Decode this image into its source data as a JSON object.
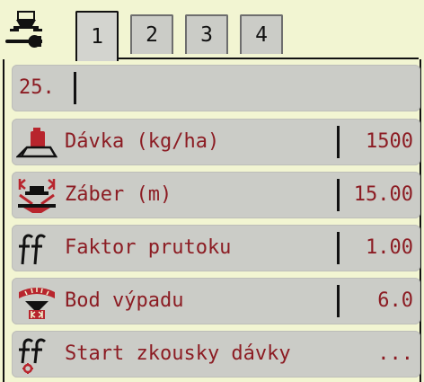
{
  "tabs": [
    {
      "label": "1",
      "active": true
    },
    {
      "label": "2",
      "active": false
    },
    {
      "label": "3",
      "active": false
    },
    {
      "label": "4",
      "active": false
    }
  ],
  "input_row": {
    "value": "25."
  },
  "rows": [
    {
      "label": "Dávka (kg/ha)",
      "value": "1500",
      "icon": "application-rate-icon"
    },
    {
      "label": "Záber (m)",
      "value": "15.00",
      "icon": "working-width-icon"
    },
    {
      "label": "Faktor prutoku",
      "value": "1.00",
      "icon": "flow-factor-icon"
    },
    {
      "label": "Bod výpadu",
      "value": "6.0",
      "icon": "drop-point-icon"
    },
    {
      "label": "Start zkousky dávky",
      "value": "...",
      "icon": "calibration-test-icon"
    }
  ],
  "colors": {
    "background": "#f2f5d2",
    "row": "#cbccc7",
    "text": "#8c1c23",
    "icon_red": "#b8252d"
  }
}
